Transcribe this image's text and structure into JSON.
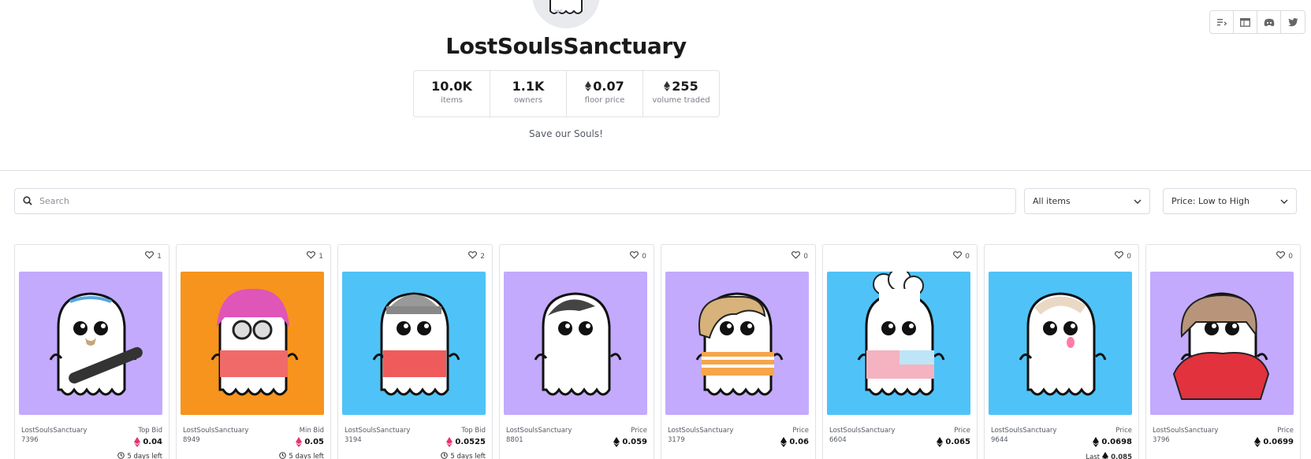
{
  "collection": {
    "title": "LostSoulsSanctuary",
    "description": "Save our Souls!",
    "stats": [
      {
        "value": "10.0K",
        "label": "items",
        "eth": false
      },
      {
        "value": "1.1K",
        "label": "owners",
        "eth": false
      },
      {
        "value": "0.07",
        "label": "floor price",
        "eth": true
      },
      {
        "value": "255",
        "label": "volume traded",
        "eth": true
      }
    ]
  },
  "social_icons": [
    "activity-icon",
    "website-icon",
    "discord-icon",
    "twitter-icon"
  ],
  "search": {
    "placeholder": "Search"
  },
  "filters": {
    "items_select": "All items",
    "sort_select": "Price: Low to High"
  },
  "colors": {
    "purple_bg": "#c3aafd",
    "orange_bg": "#f7941d",
    "blue_bg": "#4fc3f7",
    "bid_accent": "#e6336e"
  },
  "cards": [
    {
      "likes": "1",
      "collection": "LostSoulsSanctuary",
      "token": "7396",
      "price_label": "Top Bid",
      "price": "0.04",
      "bid": true,
      "footer": "5 days left",
      "bg": "#c3aafd",
      "trait": "skateboard"
    },
    {
      "likes": "1",
      "collection": "LostSoulsSanctuary",
      "token": "8949",
      "price_label": "Min Bid",
      "price": "0.05",
      "bid": true,
      "footer": "5 days left",
      "bg": "#f7941d",
      "trait": "pink-hair"
    },
    {
      "likes": "2",
      "collection": "LostSoulsSanctuary",
      "token": "3194",
      "price_label": "Top Bid",
      "price": "0.0525",
      "bid": true,
      "footer": "5 days left",
      "bg": "#4fc3f7",
      "trait": "beanie"
    },
    {
      "likes": "0",
      "collection": "LostSoulsSanctuary",
      "token": "8801",
      "price_label": "Price",
      "price": "0.059",
      "bid": false,
      "footer": "",
      "bg": "#c3aafd",
      "trait": "cap"
    },
    {
      "likes": "0",
      "collection": "LostSoulsSanctuary",
      "token": "3179",
      "price_label": "Price",
      "price": "0.06",
      "bid": false,
      "footer": "",
      "bg": "#c3aafd",
      "trait": "curly-hair"
    },
    {
      "likes": "0",
      "collection": "LostSoulsSanctuary",
      "token": "6604",
      "price_label": "Price",
      "price": "0.065",
      "bid": false,
      "footer": "",
      "bg": "#4fc3f7",
      "trait": "chef-hat"
    },
    {
      "likes": "0",
      "collection": "LostSoulsSanctuary",
      "token": "9644",
      "price_label": "Price",
      "price": "0.0698",
      "bid": false,
      "footer": "Last",
      "footer_price": "0.085",
      "bg": "#4fc3f7",
      "trait": "bandage"
    },
    {
      "likes": "0",
      "collection": "LostSoulsSanctuary",
      "token": "3796",
      "price_label": "Price",
      "price": "0.0699",
      "bid": false,
      "footer": "",
      "bg": "#c3aafd",
      "trait": "cape"
    }
  ]
}
